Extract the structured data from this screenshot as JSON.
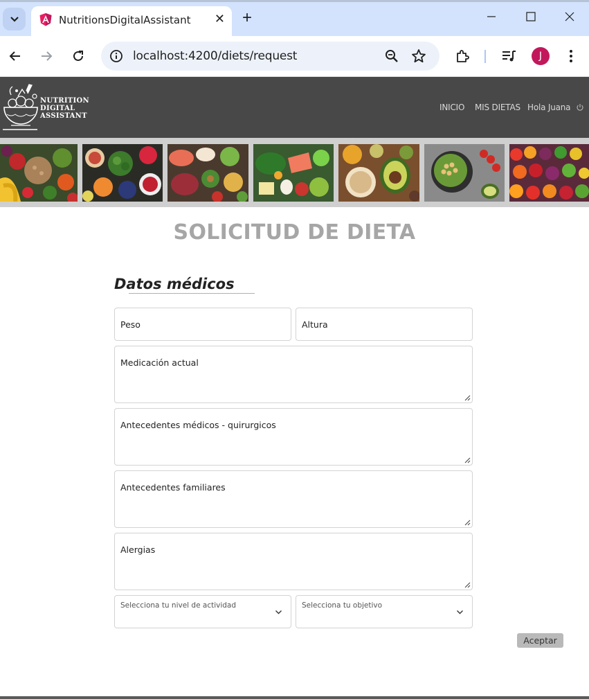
{
  "browser": {
    "tab_title": "NutritionsDigitalAssistant",
    "url": "localhost:4200/diets/request",
    "avatar_letter": "J",
    "avatar_color": "#c2185b",
    "tab_close_symbol": "✕",
    "new_tab_symbol": "+"
  },
  "header": {
    "logo_lines": [
      "NUTRITION",
      "DIGITAL",
      "ASSISTANT"
    ],
    "nav": {
      "inicio": "INICIO",
      "mis_dietas": "MIS DIETAS",
      "greeting": "Hola Juana"
    },
    "background_color": "#484848"
  },
  "strip": {
    "photos": [
      "fruits-vegetables-photo",
      "vegetables-fruits-bowls-photo",
      "meat-fish-vegetables-photo",
      "salmon-eggs-vegetables-photo",
      "avocado-grains-photo",
      "chickpea-salad-photo",
      "colorful-produce-photo"
    ]
  },
  "form": {
    "title": "SOLICITUD DE DIETA",
    "section_title": "Datos médicos",
    "fields": {
      "peso": "Peso",
      "altura": "Altura",
      "medicacion": "Medicación actual",
      "antecedentes_medicos": "Antecedentes médicos - quirurgicos",
      "antecedentes_familiares": "Antecedentes familiares",
      "alergias": "Alergias",
      "nivel_actividad": "Selecciona tu nivel de actividad",
      "objetivo": "Selecciona tu objetivo"
    },
    "submit_label": "Aceptar"
  }
}
